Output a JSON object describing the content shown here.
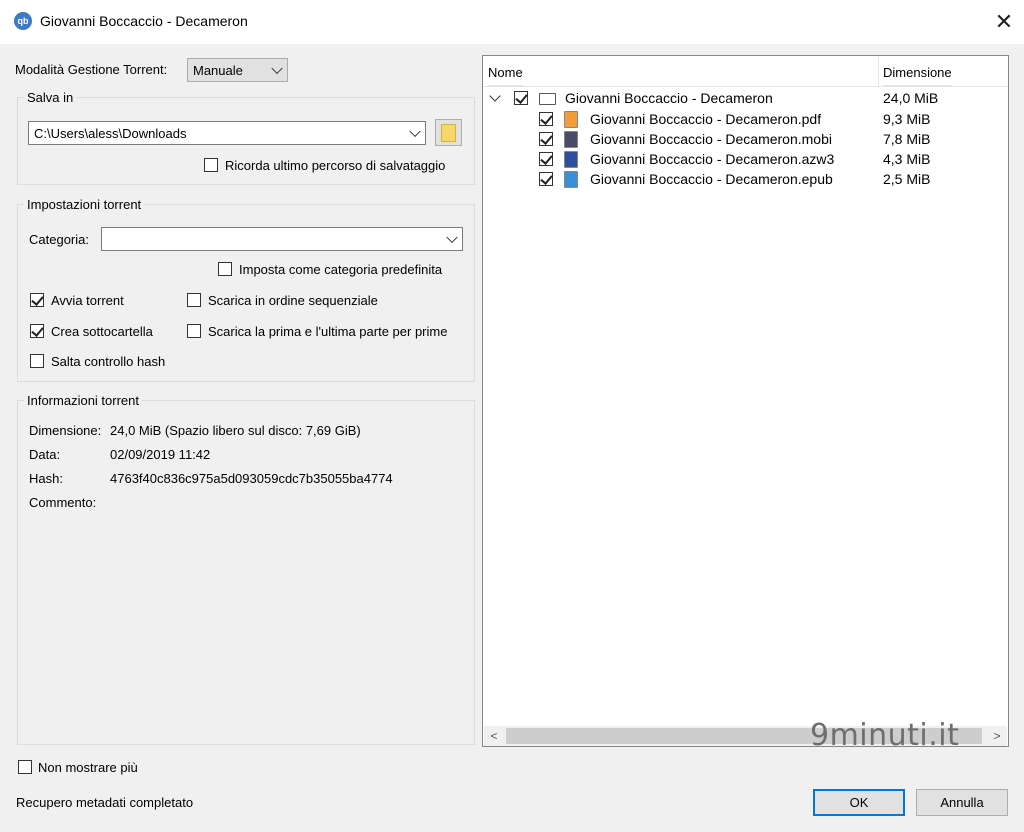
{
  "window": {
    "title": "Giovanni Boccaccio - Decameron",
    "icon_text": "qb",
    "close_glyph": "✕"
  },
  "mode": {
    "label": "Modalità Gestione Torrent:",
    "value": "Manuale"
  },
  "save_in": {
    "title": "Salva in",
    "path": "C:\\Users\\aless\\Downloads",
    "remember_label": "Ricorda ultimo percorso di salvataggio",
    "remember_checked": false
  },
  "torrent_settings": {
    "title": "Impostazioni torrent",
    "category_label": "Categoria:",
    "category_value": "",
    "default_category_label": "Imposta come categoria predefinita",
    "start_label": "Avvia torrent",
    "sequential_label": "Scarica in ordine sequenziale",
    "subfolder_label": "Crea sottocartella",
    "first_last_label": "Scarica la prima e l'ultima parte per prime",
    "skip_hash_label": "Salta controllo hash"
  },
  "torrent_info": {
    "title": "Informazioni torrent",
    "size_label": "Dimensione:",
    "size_value": "24,0 MiB (Spazio libero sul disco: 7,69 GiB)",
    "date_label": "Data:",
    "date_value": "02/09/2019 11:42",
    "hash_label": "Hash:",
    "hash_value": "4763f40c836c975a5d093059cdc7b35055ba4774",
    "comment_label": "Commento:"
  },
  "files": {
    "col_name": "Nome",
    "col_size": "Dimensione",
    "root": {
      "name": "Giovanni Boccaccio - Decameron",
      "size": "24,0 MiB"
    },
    "items": [
      {
        "name": "Giovanni Boccaccio - Decameron.pdf",
        "size": "9,3 MiB",
        "icon": "pdf-file-icon",
        "color": "#f29d38"
      },
      {
        "name": "Giovanni Boccaccio - Decameron.mobi",
        "size": "7,8 MiB",
        "icon": "mobi-file-icon",
        "color": "#4a4a6a"
      },
      {
        "name": "Giovanni Boccaccio - Decameron.azw3",
        "size": "4,3 MiB",
        "icon": "azw3-file-icon",
        "color": "#2d4f9e"
      },
      {
        "name": "Giovanni Boccaccio - Decameron.epub",
        "size": "2,5 MiB",
        "icon": "epub-file-icon",
        "color": "#3a8fd6"
      }
    ]
  },
  "footer": {
    "dont_show_label": "Non mostrare più",
    "status": "Recupero metadati completato",
    "ok_label": "OK",
    "cancel_label": "Annulla"
  },
  "watermark": "9minuti.it"
}
